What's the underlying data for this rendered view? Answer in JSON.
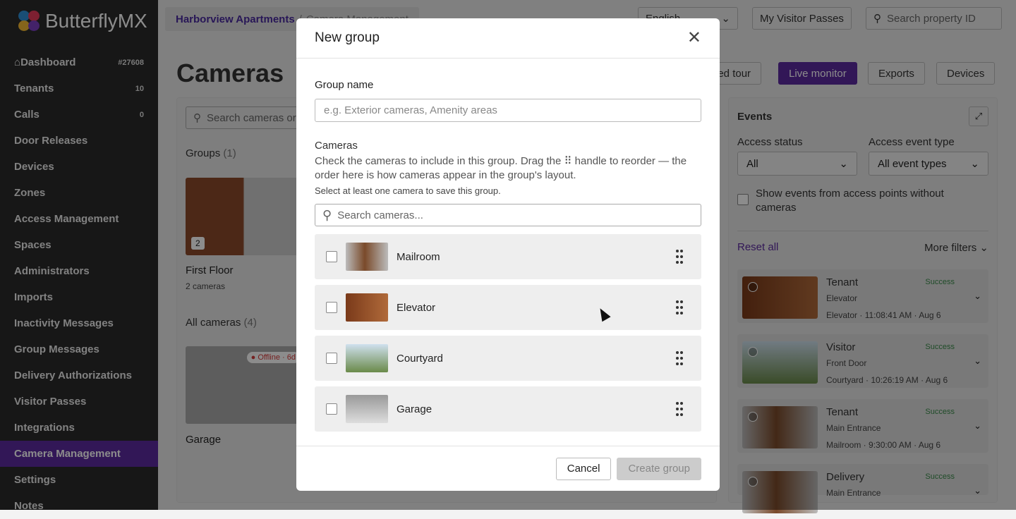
{
  "app": {
    "brand": "ButterflyMX"
  },
  "sidebar": {
    "items": [
      {
        "label": "Dashboard",
        "badge": "#27608"
      },
      {
        "label": "Tenants",
        "badge": "10"
      },
      {
        "label": "Calls",
        "badge": "0"
      },
      {
        "label": "Door Releases",
        "badge": ""
      },
      {
        "label": "Devices",
        "badge": ""
      },
      {
        "label": "Zones",
        "badge": ""
      },
      {
        "label": "Access Management",
        "badge": ""
      },
      {
        "label": "Spaces",
        "badge": ""
      },
      {
        "label": "Administrators",
        "badge": ""
      },
      {
        "label": "Imports",
        "badge": ""
      },
      {
        "label": "Inactivity Messages",
        "badge": ""
      },
      {
        "label": "Group Messages",
        "badge": ""
      },
      {
        "label": "Delivery Authorizations",
        "badge": ""
      },
      {
        "label": "Visitor Passes",
        "badge": ""
      },
      {
        "label": "Integrations",
        "badge": ""
      },
      {
        "label": "Camera Management",
        "badge": "",
        "active": true
      },
      {
        "label": "Settings",
        "badge": ""
      },
      {
        "label": "Notes",
        "badge": ""
      }
    ]
  },
  "header": {
    "breadcrumb_property": "Harborview Apartments",
    "breadcrumb_sep": "/",
    "breadcrumb_page": "Camera Management",
    "language": "English",
    "visitor_passes": "My Visitor Passes",
    "search_placeholder": "Search property ID"
  },
  "page": {
    "title": "Cameras",
    "actions": {
      "tour": "ded tour",
      "live": "Live monitor",
      "exports": "Exports",
      "devices": "Devices"
    },
    "search_placeholder": "Search cameras or",
    "groups_label": "Groups",
    "groups_count": "(1)",
    "group_card": {
      "name": "First Floor",
      "sub": "2 cameras",
      "count": "2"
    },
    "all_label": "All cameras",
    "all_count": "(4)",
    "garage_card": {
      "name": "Garage",
      "status": "Offline",
      "age": "6d"
    }
  },
  "events": {
    "title": "Events",
    "access_status_label": "Access status",
    "access_status_value": "All",
    "event_type_label": "Access event type",
    "event_type_value": "All event types",
    "checkbox_label": "Show events from access points without cameras",
    "reset": "Reset all",
    "more": "More filters",
    "items": [
      {
        "type": "Tenant",
        "status": "Success",
        "point": "Elevator",
        "camera": "Elevator",
        "time": "11:08:41 AM",
        "date": "Aug 6"
      },
      {
        "type": "Visitor",
        "status": "Success",
        "point": "Front Door",
        "camera": "Courtyard",
        "time": "10:26:19 AM",
        "date": "Aug 6"
      },
      {
        "type": "Tenant",
        "status": "Success",
        "point": "Main Entrance",
        "camera": "Mailroom",
        "time": "9:30:00 AM",
        "date": "Aug 6"
      },
      {
        "type": "Delivery",
        "status": "Success",
        "point": "Main Entrance",
        "camera": "",
        "time": "",
        "date": ""
      }
    ]
  },
  "modal": {
    "title": "New group",
    "group_name_label": "Group name",
    "group_name_placeholder": "e.g. Exterior cameras, Amenity areas",
    "cameras_label": "Cameras",
    "help": "Check the cameras to include in this group. Drag the ⠿ handle to reorder — the order here is how cameras appear in the group's layout.",
    "hint": "Select at least one camera to save this group.",
    "search_placeholder": "Search cameras...",
    "cameras": [
      {
        "name": "Mailroom"
      },
      {
        "name": "Elevator"
      },
      {
        "name": "Courtyard"
      },
      {
        "name": "Garage"
      }
    ],
    "cancel": "Cancel",
    "create": "Create group"
  },
  "colors": {
    "accent": "#5b2a9e",
    "success": "#3a8a4a",
    "offline": "#d63b3b"
  }
}
